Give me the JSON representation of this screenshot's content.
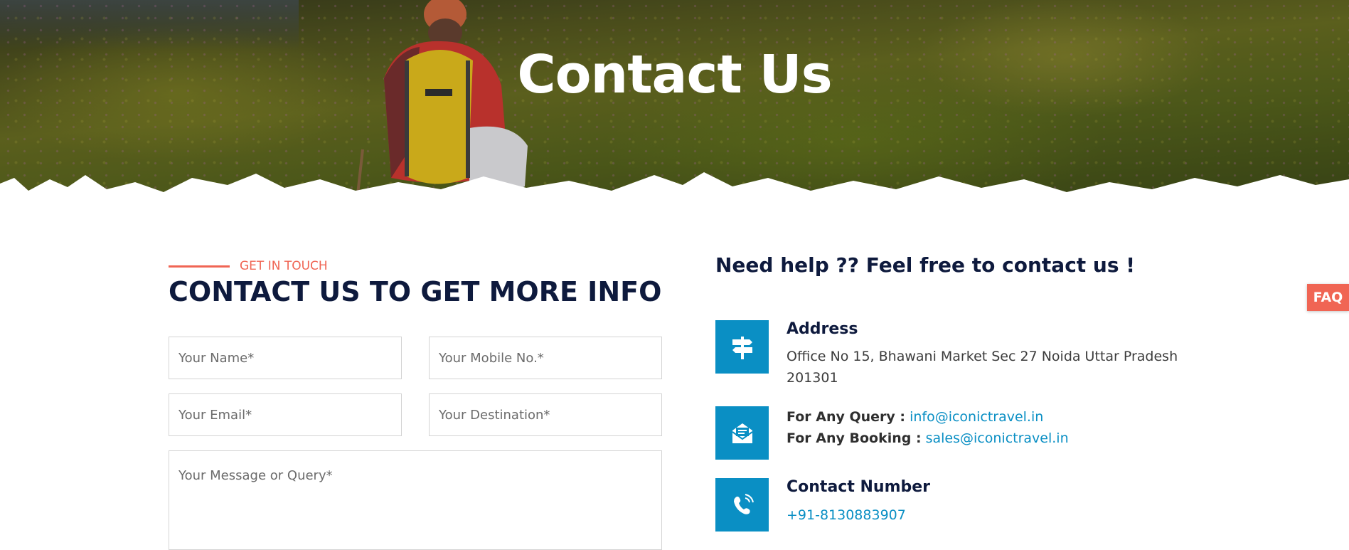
{
  "hero": {
    "title": "Contact Us"
  },
  "form": {
    "eyebrow": "GET IN TOUCH",
    "title": "CONTACT US TO GET MORE INFO",
    "name_placeholder": "Your Name*",
    "mobile_placeholder": "Your Mobile No.*",
    "email_placeholder": "Your Email*",
    "destination_placeholder": "Your Destination*",
    "message_placeholder": "Your Message or Query*"
  },
  "info": {
    "title": "Need help ?? Feel free to contact us !",
    "address": {
      "heading": "Address",
      "line1": "Office No 15, Bhawani Market Sec 27 Noida Uttar Pradesh",
      "line2": "201301",
      "icon": "signpost-icon"
    },
    "email": {
      "query_label": "For Any Query :",
      "query_value": "info@iconictravel.in",
      "booking_label": "For Any Booking :",
      "booking_value": "sales@iconictravel.in",
      "icon": "envelope-icon"
    },
    "phone": {
      "heading": "Contact Number",
      "value": "+91-8130883907",
      "icon": "phone-icon"
    }
  },
  "faq": {
    "label": "FAQ"
  },
  "colors": {
    "accent": "#f06554",
    "navy": "#0e1a3d",
    "blue": "#0a8fc4"
  }
}
